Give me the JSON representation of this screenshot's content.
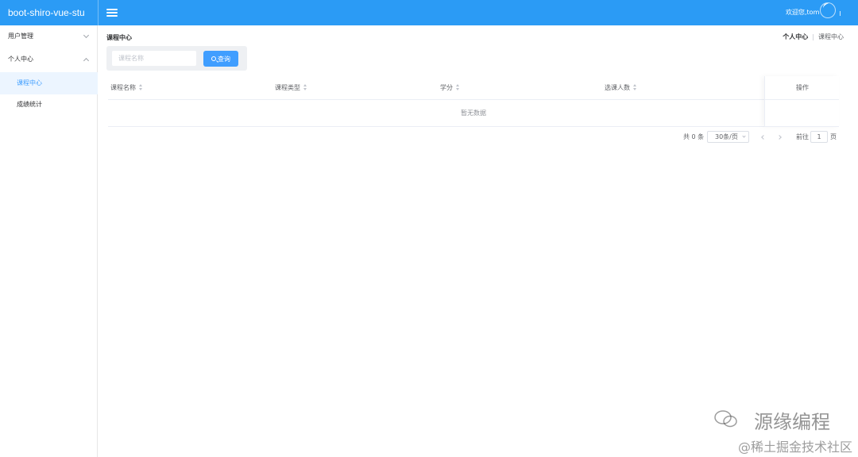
{
  "header": {
    "brand": "boot-shiro-vue-stu",
    "welcome": "欢迎您,tom"
  },
  "sidebar": {
    "items": [
      {
        "label": "用户管理",
        "expanded": false
      },
      {
        "label": "个人中心",
        "expanded": true
      },
      {
        "label": "课程中心",
        "active": true
      },
      {
        "label": "成绩统计"
      }
    ]
  },
  "page": {
    "title": "课程中心",
    "breadcrumb": [
      "个人中心",
      "课程中心"
    ]
  },
  "search": {
    "placeholder": "课程名称",
    "value": "",
    "button_label": "查询"
  },
  "table": {
    "columns": [
      "课程名称",
      "课程类型",
      "学分",
      "选课人数",
      "操作"
    ],
    "rows": [],
    "empty_text": "暂无数据"
  },
  "pagination": {
    "total_text": "共 0 条",
    "page_size": "30条/页",
    "goto_label": "前往",
    "current_page": "1",
    "page_suffix": "页"
  },
  "watermark": {
    "line1": "源缘编程",
    "line2": "@稀土掘金技术社区"
  },
  "colors": {
    "header_bg": "#2b9bf5",
    "primary": "#409eff",
    "active_bg": "#ecf5ff"
  }
}
